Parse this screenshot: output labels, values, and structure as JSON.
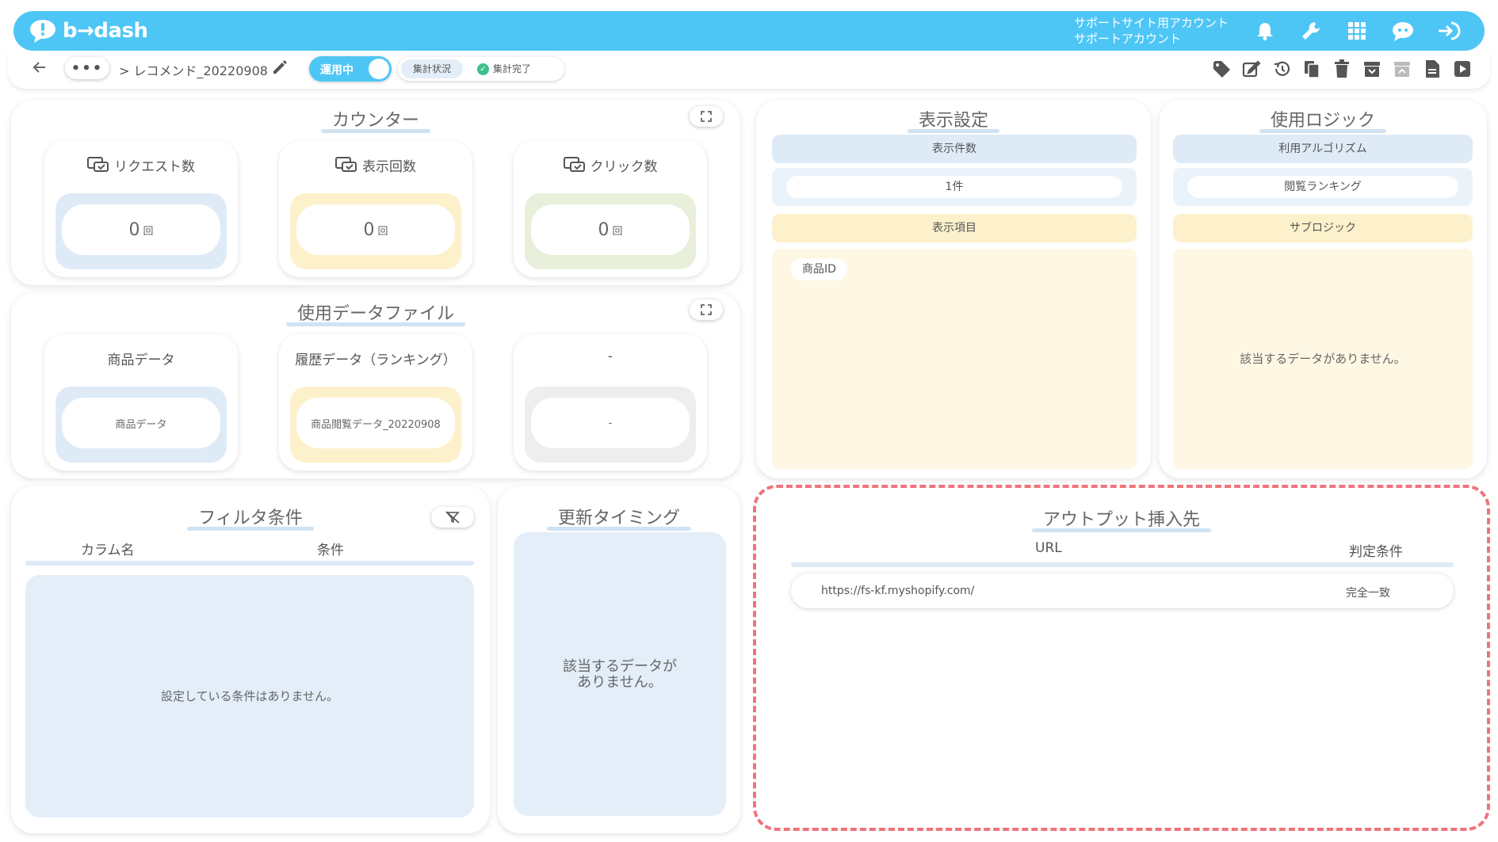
{
  "header": {
    "brand": "b→dash",
    "account_line1": "サポートサイト用アカウント",
    "account_line2": "サポートアカウント",
    "icons": [
      "bell-icon",
      "wrench-icon",
      "apps-grid-icon",
      "chat-bot-icon",
      "logout-icon"
    ]
  },
  "breadcrumb": {
    "more": "•••",
    "path": "> レコメンド_20220908",
    "toggle_label": "運用中",
    "status_label": "集計状況",
    "status_value": "集計完了",
    "toolbar_icons": [
      "tag-icon",
      "edit-icon",
      "history-icon",
      "copy-icon",
      "trash-icon",
      "archive-icon",
      "archive-disabled-icon",
      "document-icon",
      "play-icon"
    ]
  },
  "colors": {
    "accent": "#4ec6f5",
    "highlight_border": "#f0737b"
  },
  "counter": {
    "title": "カウンター",
    "cards": [
      {
        "label": "リクエスト数",
        "value": "0",
        "unit": "回"
      },
      {
        "label": "表示回数",
        "value": "0",
        "unit": "回"
      },
      {
        "label": "クリック数",
        "value": "0",
        "unit": "回"
      }
    ]
  },
  "datafiles": {
    "title": "使用データファイル",
    "cards": [
      {
        "label": "商品データ",
        "value": "商品データ"
      },
      {
        "label": "履歴データ（ランキング）",
        "value": "商品閲覧データ_20220908"
      },
      {
        "label": "-",
        "value": "-"
      }
    ]
  },
  "display": {
    "title": "表示設定",
    "count_header": "表示件数",
    "count_value": "1件",
    "items_header": "表示項目",
    "items": [
      "商品ID"
    ]
  },
  "logic": {
    "title": "使用ロジック",
    "algo_header": "利用アルゴリズム",
    "algo_value": "閲覧ランキング",
    "sub_header": "サブロジック",
    "sub_empty": "該当するデータがありません。"
  },
  "filter": {
    "title": "フィルタ条件",
    "col_name": "カラム名",
    "col_cond": "条件",
    "empty": "設定している条件はありません。"
  },
  "timing": {
    "title": "更新タイミング",
    "empty_line1": "該当するデータが",
    "empty_line2": "ありません。"
  },
  "output": {
    "title": "アウトプット挿入先",
    "col_url": "URL",
    "col_cond": "判定条件",
    "rows": [
      {
        "url": "https://fs-kf.myshopify.com/",
        "cond": "完全一致"
      }
    ]
  }
}
